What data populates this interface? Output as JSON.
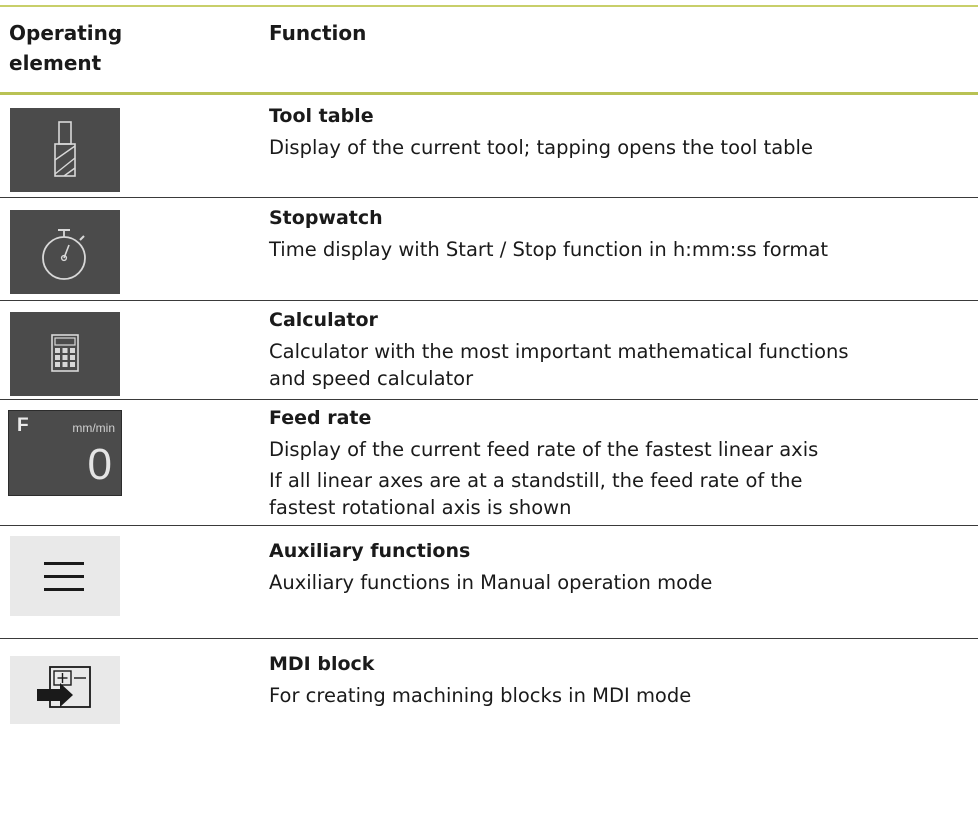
{
  "header": {
    "col_element": [
      "Operating",
      "element"
    ],
    "col_function": "Function"
  },
  "rows": [
    {
      "icon": "tool-table-icon",
      "title": "Tool table",
      "desc": [
        "Display of the current tool; tapping opens the tool table"
      ]
    },
    {
      "icon": "stopwatch-icon",
      "title": "Stopwatch",
      "desc": [
        "Time display with Start / Stop function in h:mm:ss format"
      ]
    },
    {
      "icon": "calculator-icon",
      "title": "Calculator",
      "desc": [
        "Calculator with the most important mathematical functions",
        "and speed calculator"
      ]
    },
    {
      "icon": "feed-rate-display",
      "title": "Feed rate",
      "feed_icon": {
        "letter": "F",
        "unit": "mm/min",
        "value": "0"
      },
      "desc": [
        "Display of the current feed rate of the fastest linear axis",
        "If all linear axes are at a standstill, the feed rate of the",
        "fastest rotational axis is shown"
      ]
    },
    {
      "icon": "menu-icon",
      "title": "Auxiliary functions",
      "desc": [
        "Auxiliary functions in Manual operation mode"
      ]
    },
    {
      "icon": "mdi-block-icon",
      "title": "MDI block",
      "desc": [
        "For creating machining blocks in MDI mode"
      ]
    }
  ],
  "colors": {
    "accent_line": "#b9c254",
    "icon_dark_bg": "#4b4b4b",
    "icon_light_bg": "#e9e9e9"
  }
}
